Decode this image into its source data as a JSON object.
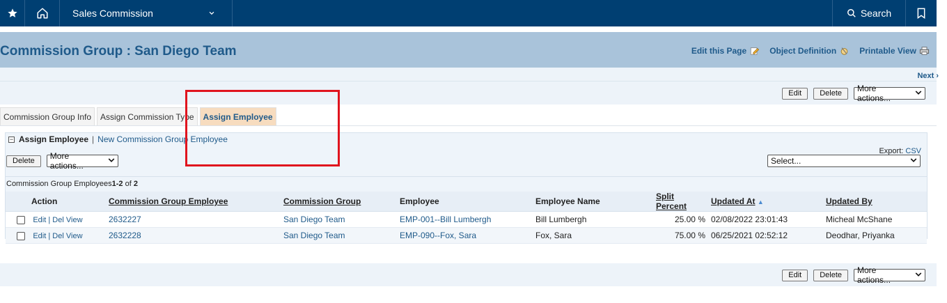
{
  "nav": {
    "app_name": "Sales Commission",
    "search_label": "Search"
  },
  "header": {
    "title": "Commission Group : San Diego Team",
    "links": {
      "edit_page": "Edit this Page",
      "object_definition": "Object Definition",
      "printable_view": "Printable View"
    },
    "next_label": "Next ›"
  },
  "actions": {
    "edit": "Edit",
    "delete": "Delete",
    "more_actions": "More actions..."
  },
  "tabs": [
    "Commission Group Info",
    "Assign Commission Type",
    "Assign Employee"
  ],
  "active_tab": "Assign Employee",
  "section": {
    "title": "Assign Employee",
    "separator": "|",
    "new_link": "New Commission Group Employee",
    "export_label": "Export:",
    "export_csv": "CSV",
    "delete_button": "Delete",
    "more_actions": "More actions...",
    "select_placeholder": "Select...",
    "count_prefix": "Commission Group Employees ",
    "count_range": "1-2",
    "count_of": " of ",
    "count_total": "2"
  },
  "table": {
    "columns": [
      "Action",
      "Commission Group Employee",
      "Commission Group",
      "Employee",
      "Employee Name",
      "Split Percent",
      "Updated At",
      "Updated By"
    ],
    "action_links": {
      "edit": "Edit",
      "sep": "|",
      "del": "Del",
      "view": "View"
    },
    "rows": [
      {
        "id": "2632227",
        "group": "San Diego Team",
        "employee": "EMP-001--Bill Lumbergh",
        "name": "Bill Lumbergh",
        "split": "25.00 %",
        "updated_at": "02/08/2022 23:01:43",
        "updated_by": "Micheal McShane"
      },
      {
        "id": "2632228",
        "group": "San Diego Team",
        "employee": "EMP-090--Fox, Sara",
        "name": "Fox, Sara",
        "split": "75.00 %",
        "updated_at": "06/25/2021 02:52:12",
        "updated_by": "Deodhar, Priyanka"
      }
    ]
  },
  "colors": {
    "nav_bg": "#003f72",
    "header_bg": "#a9c3da",
    "active_tab_bg": "#f7dcbf",
    "link": "#1f5a8a",
    "highlight": "#e0141e"
  }
}
